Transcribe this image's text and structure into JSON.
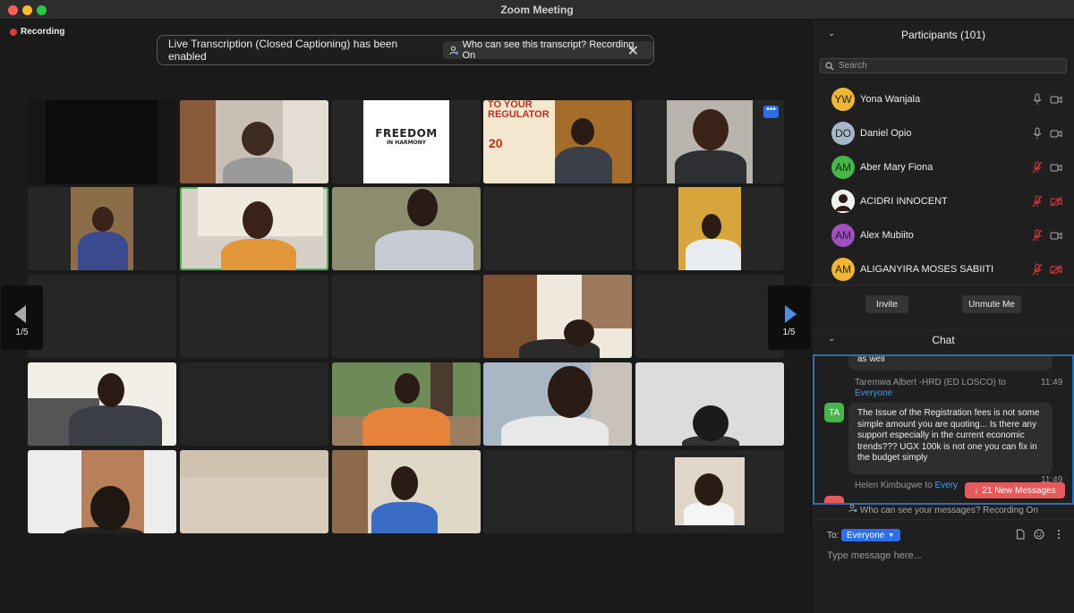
{
  "window": {
    "title": "Zoom Meeting"
  },
  "recording": {
    "label": "Recording"
  },
  "banner": {
    "text": "Live Transcription (Closed Captioning) has been enabled",
    "pill": "Who can see this transcript? Recording On"
  },
  "gallery": {
    "page_left": "1/5",
    "page_right": "1/5",
    "more_icon": "ellipsis-icon",
    "tiles": [
      {
        "kind": "dark"
      },
      {
        "kind": "man-desk"
      },
      {
        "kind": "logo",
        "logo_text_1": "FREEDOM",
        "logo_text_2": "IN HARMONY"
      },
      {
        "kind": "poster",
        "poster_line_1": "TO YOUR",
        "poster_line_2": "REGULATOR",
        "poster_date": "20"
      },
      {
        "kind": "suit"
      },
      {
        "kind": "wall"
      },
      {
        "kind": "woman-shelf",
        "active": true
      },
      {
        "kind": "man-wall"
      },
      {
        "kind": "empty"
      },
      {
        "kind": "man-yellow"
      },
      {
        "kind": "empty"
      },
      {
        "kind": "empty"
      },
      {
        "kind": "empty"
      },
      {
        "kind": "room"
      },
      {
        "kind": "empty"
      },
      {
        "kind": "man-sofa"
      },
      {
        "kind": "empty"
      },
      {
        "kind": "tree"
      },
      {
        "kind": "man-close"
      },
      {
        "kind": "man-wall2"
      },
      {
        "kind": "old-man"
      },
      {
        "kind": "blur-wall"
      },
      {
        "kind": "woman-door"
      },
      {
        "kind": "empty"
      },
      {
        "kind": "woman-pose"
      }
    ]
  },
  "participants": {
    "title": "Participants (101)",
    "search_placeholder": "Search",
    "list": [
      {
        "initials": "YW",
        "name": "Yona Wanjala",
        "color": "#f2b636",
        "muted": false,
        "video_off": false
      },
      {
        "initials": "DO",
        "name": "Daniel Opio",
        "color": "#a7b6c9",
        "muted": false,
        "video_off": false
      },
      {
        "initials": "AM",
        "name": "Aber Mary Fiona",
        "color": "#45b649",
        "muted": true,
        "video_off": false
      },
      {
        "initials": "",
        "name": "ACIDRI INNOCENT",
        "color": "#ffffff",
        "muted": true,
        "video_off": true
      },
      {
        "initials": "AM",
        "name": "Alex Mubiito",
        "color": "#a24fbf",
        "muted": true,
        "video_off": false
      },
      {
        "initials": "AM",
        "name": "ALIGANYIRA MOSES SABIITI",
        "color": "#f2b636",
        "muted": true,
        "video_off": true
      }
    ],
    "invite_label": "Invite",
    "unmute_label": "Unmute Me"
  },
  "chat": {
    "title": "Chat",
    "prev_tail": "as well",
    "msg1": {
      "sender": "Taremwa Albert -HRD (ED LOSCO) to",
      "recipient": "Everyone",
      "time": "11:49",
      "avatar": "TA",
      "text": "The Issue of the Registration fees is not some simple amount you are quoting... Is there any support especially in the current economic trends??? UGX 100k is not one you can fix in the budget simply"
    },
    "msg2": {
      "sender": "Helen Kimbugwe to",
      "recipient": "Every",
      "time": "11:49"
    },
    "new_messages": "21 New Messages",
    "who_can_see": "Who can see your messages? Recording On",
    "to_label": "To:",
    "to_value": "Everyone",
    "input_placeholder": "Type message here..."
  }
}
